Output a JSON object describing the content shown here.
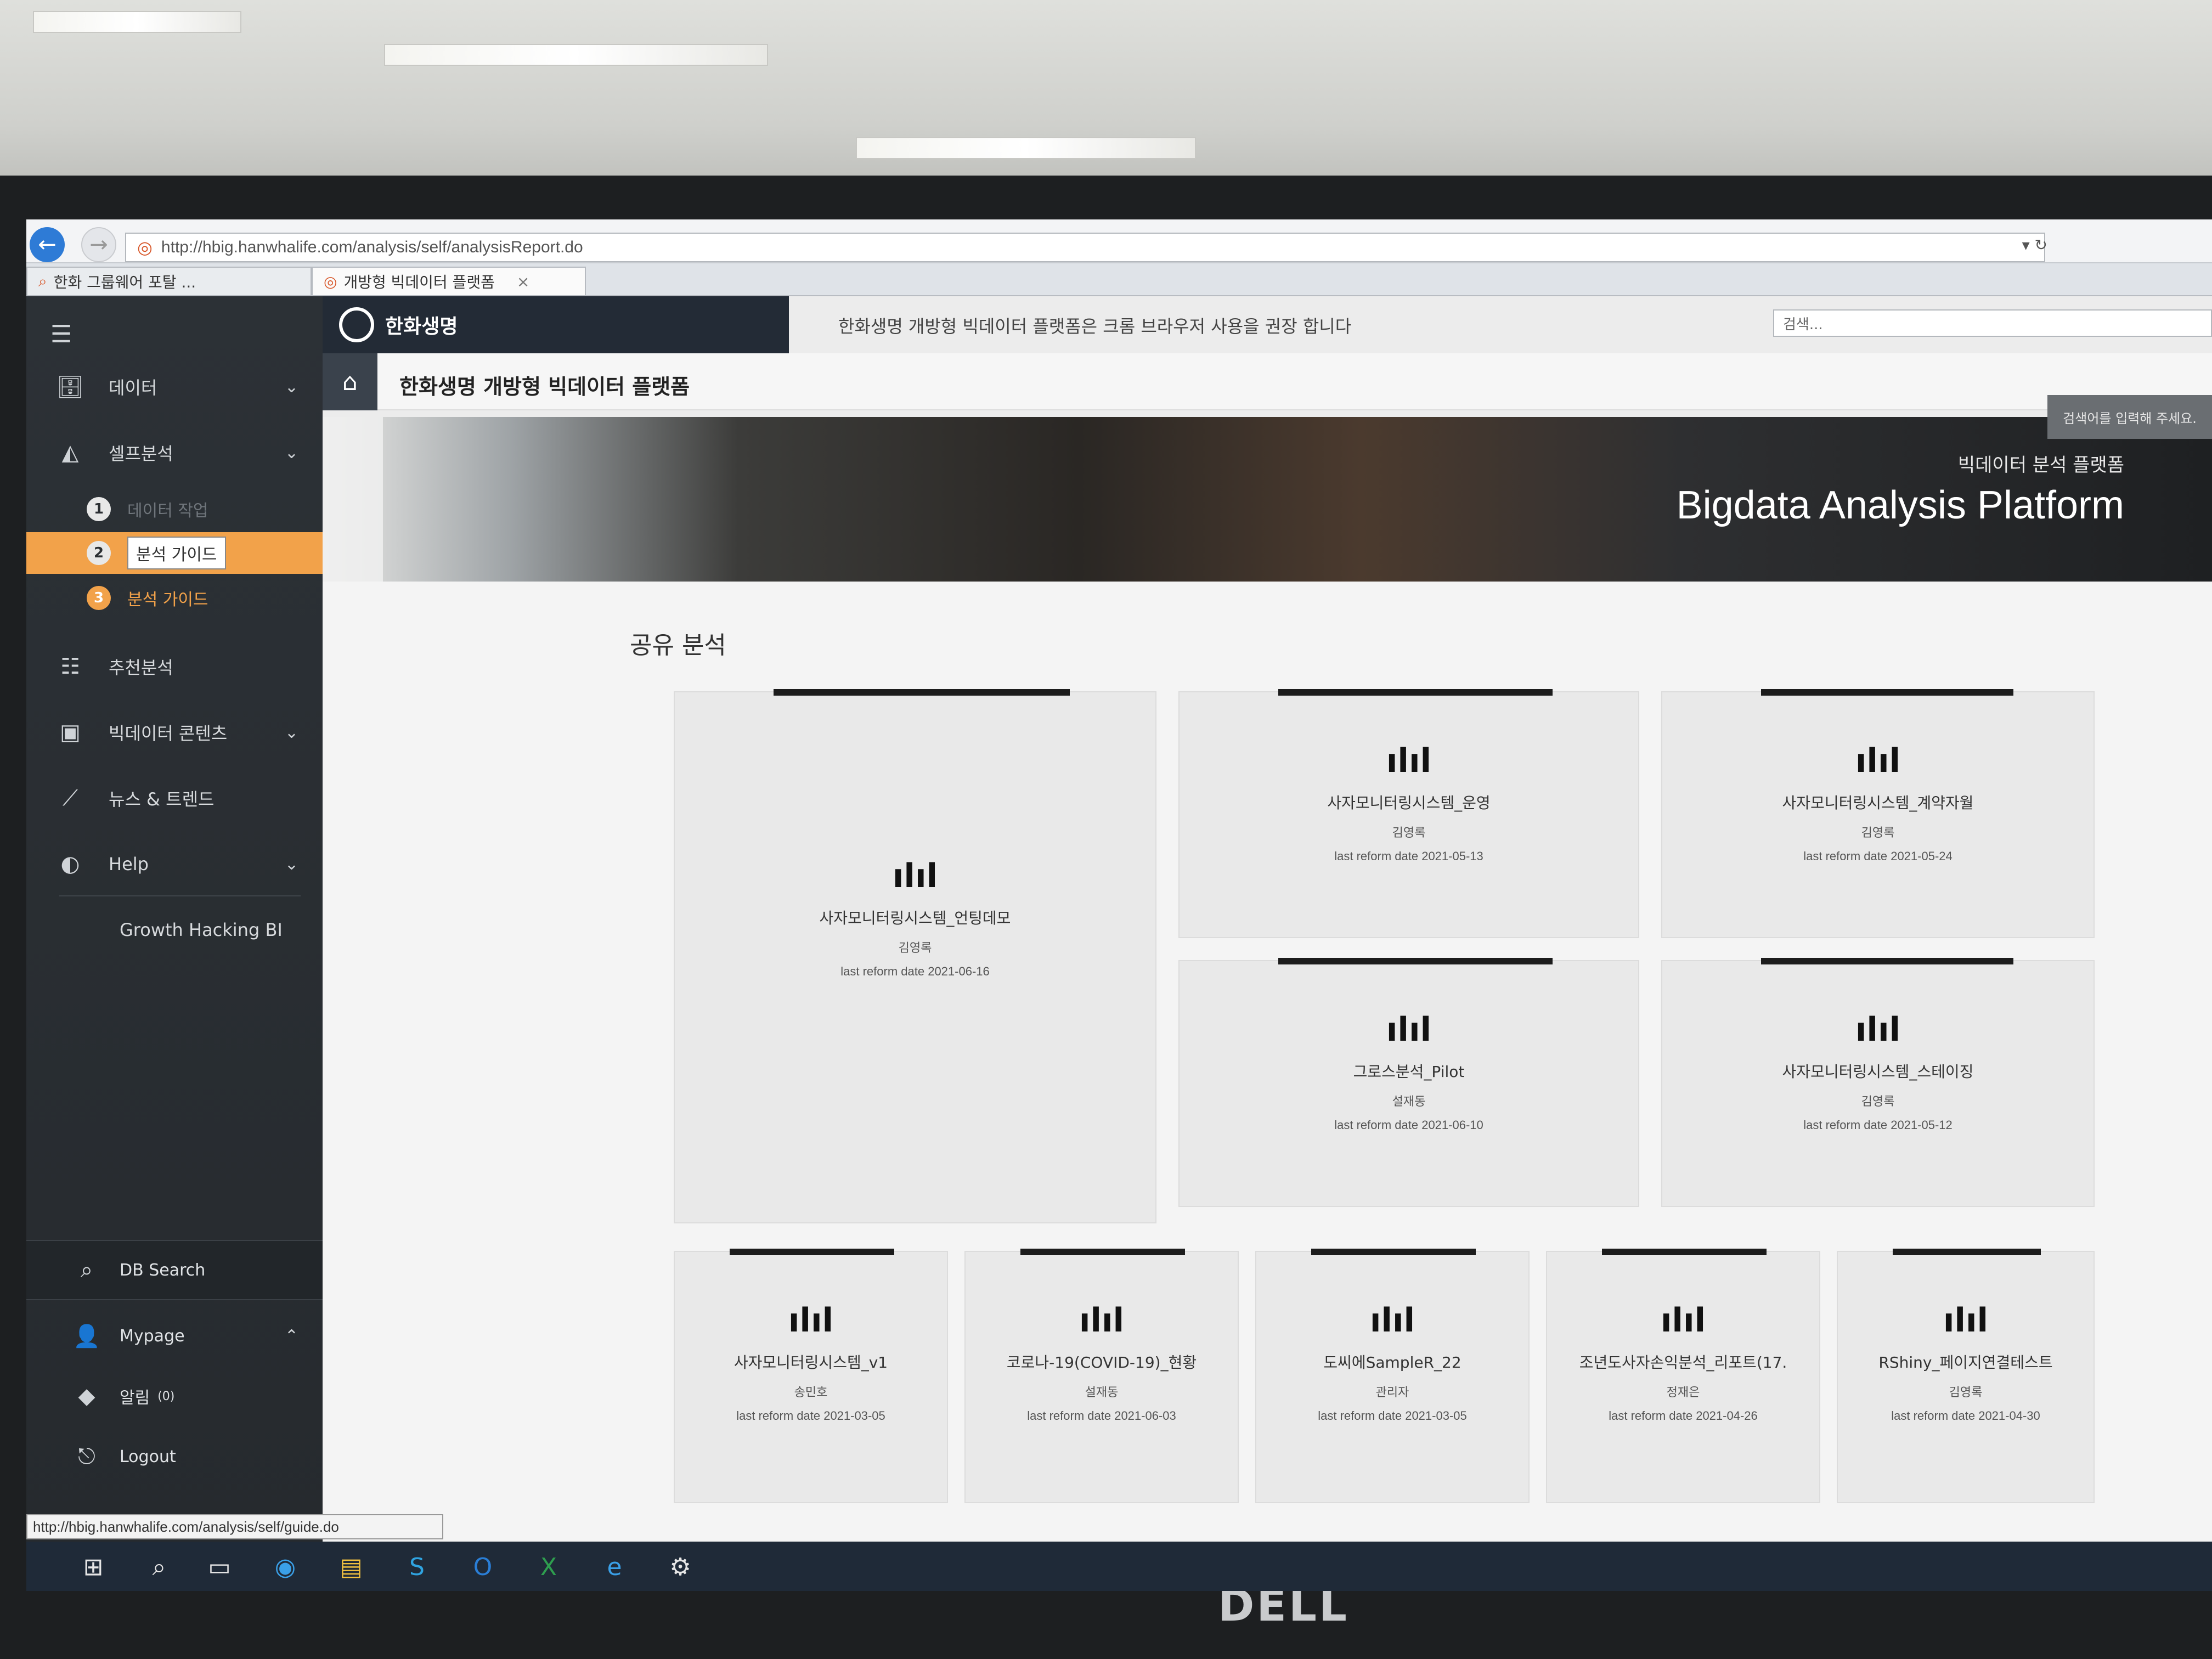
{
  "browser": {
    "url": "http://hbig.hanwhalife.com/analysis/self/analysisReport.do",
    "tabs": [
      {
        "label": "한화 그룹웨어 포탈 ..."
      },
      {
        "label": "개방형 빅데이터 플랫폼",
        "close": "×"
      }
    ],
    "search_placeholder": "검색..."
  },
  "sidebar": {
    "items": [
      {
        "label": "데이터",
        "icon": "database-icon"
      },
      {
        "label": "셀프분석",
        "icon": "area-chart-icon"
      }
    ],
    "subitems": [
      {
        "num": "1",
        "label": "데이터 작업"
      },
      {
        "num": "2",
        "label": "분석 가이드"
      },
      {
        "num": "3",
        "label": "분석 가이드"
      }
    ],
    "more_items": [
      {
        "label": "추천분석",
        "icon": "list-icon"
      },
      {
        "label": "빅데이터 콘텐츠",
        "icon": "contents-icon"
      },
      {
        "label": "뉴스 & 트렌드",
        "icon": "trend-icon"
      },
      {
        "label": "Help",
        "icon": "headset-icon"
      }
    ],
    "growth": "Growth Hacking BI",
    "bottom": {
      "db_search": "DB Search",
      "mypage": "Mypage",
      "alarm": "알림",
      "alarm_count": "(0)",
      "logout": "Logout"
    }
  },
  "header": {
    "logo_text": "한화생명",
    "notice": "한화생명 개방형 빅데이터 플랫폼은 크롬 브라우저 사용을 권장 합니다",
    "platform_title": "한화생명 개방형 빅데이터 플랫폼",
    "search_hint": "검색어를 입력해 주세요."
  },
  "banner": {
    "subtitle": "빅데이터 분석 플랫폼",
    "title": "Bigdata Analysis Platform"
  },
  "section_title": "공유 분석",
  "cards": [
    {
      "title": "사자모니터링시스템_언팅데모",
      "author": "김영록",
      "date": "last reform date 2021-06-16"
    },
    {
      "title": "사자모니터링시스템_운영",
      "author": "김영록",
      "date": "last reform date 2021-05-13"
    },
    {
      "title": "사자모니터링시스템_계약자월",
      "author": "김영록",
      "date": "last reform date 2021-05-24"
    },
    {
      "title": "그로스분석_Pilot",
      "author": "설재동",
      "date": "last reform date 2021-06-10"
    },
    {
      "title": "사자모니터링시스템_스테이징",
      "author": "김영록",
      "date": "last reform date 2021-05-12"
    },
    {
      "title": "사자모니터링시스템_v1",
      "author": "송민호",
      "date": "last reform date 2021-03-05"
    },
    {
      "title": "코로나-19(COVID-19)_현황",
      "author": "설재동",
      "date": "last reform date 2021-06-03"
    },
    {
      "title": "도씨에SampleR_22",
      "author": "관리자",
      "date": "last reform date 2021-03-05"
    },
    {
      "title": "조년도사자손익분석_리포트(17.",
      "author": "정재은",
      "date": "last reform date 2021-04-26"
    },
    {
      "title": "RShiny_페이지연결테스트",
      "author": "김영록",
      "date": "last reform date 2021-04-30"
    }
  ],
  "status_url": "http://hbig.hanwhalife.com/analysis/self/guide.do",
  "monitor_brand": "DELL"
}
